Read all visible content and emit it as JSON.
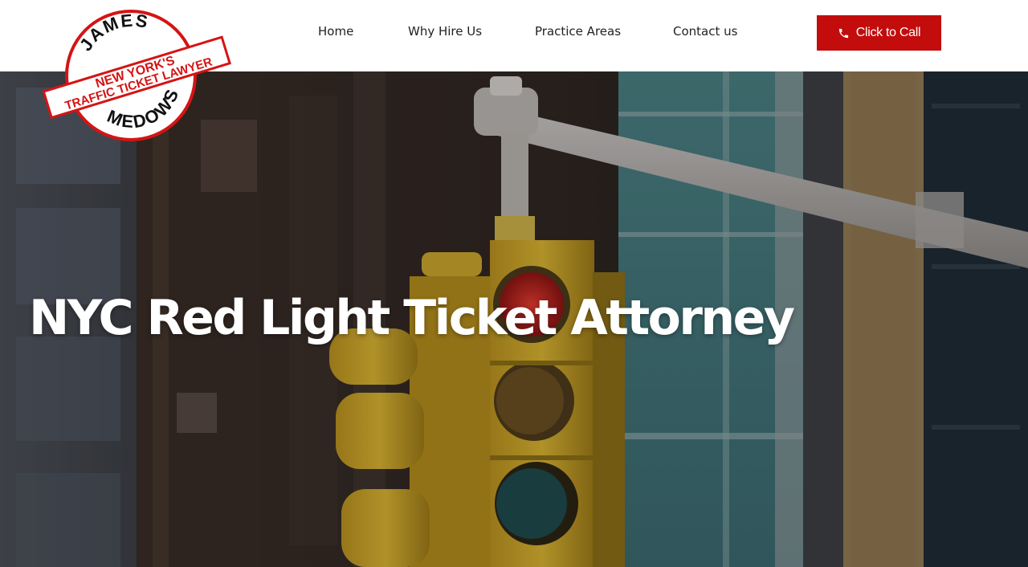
{
  "logo": {
    "top_word": "JAMES",
    "banner_line1": "NEW YORK'S",
    "banner_line2": "TRAFFIC TICKET LAWYER",
    "bottom_word": "MEDOWS"
  },
  "nav": {
    "items": [
      {
        "label": "Home"
      },
      {
        "label": "Why Hire Us"
      },
      {
        "label": "Practice Areas"
      },
      {
        "label": "Contact us"
      }
    ]
  },
  "cta": {
    "label": "Click to Call",
    "icon": "phone-icon"
  },
  "hero": {
    "title": "NYC Red Light Ticket Attorney"
  },
  "colors": {
    "accent": "#c30c0c",
    "nav_text": "#222222",
    "hero_text": "#ffffff"
  }
}
